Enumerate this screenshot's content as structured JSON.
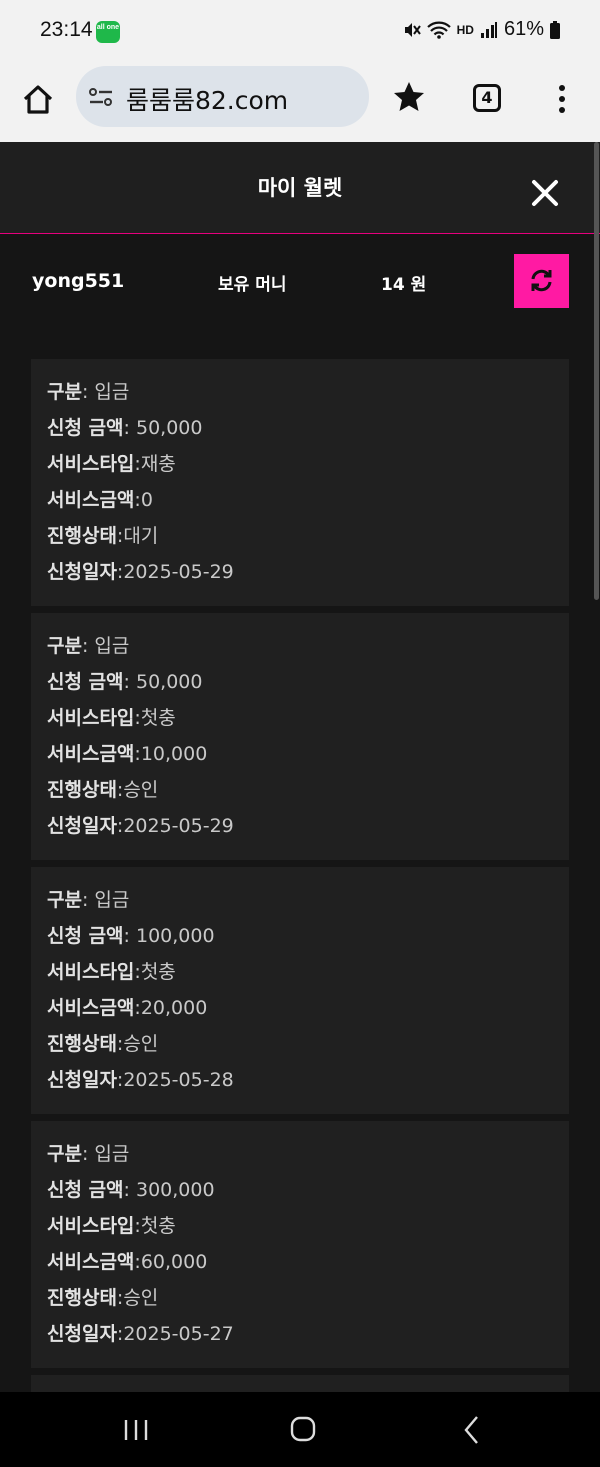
{
  "status_bar": {
    "time": "23:14",
    "app_badge": "all one",
    "hd_label": "HD",
    "battery_text": "61%"
  },
  "browser": {
    "url": "룸룸룸82.com",
    "tab_count": "4"
  },
  "wallet": {
    "title": "마이 월렛",
    "username": "yong551",
    "money_label": "보유 머니",
    "money_value": "14 원",
    "accent_color": "#ff1aa3"
  },
  "labels": {
    "category": "구분",
    "amount": "신청 금액",
    "service_type": "서비스타입",
    "service_amount": "서비스금액",
    "status": "진행상태",
    "date": "신청일자"
  },
  "transactions": [
    {
      "category": "입금",
      "amount": "50,000",
      "service_type": "재충",
      "service_amount": "0",
      "status": "대기",
      "date": "2025-05-29"
    },
    {
      "category": "입금",
      "amount": "50,000",
      "service_type": "첫충",
      "service_amount": "10,000",
      "status": "승인",
      "date": "2025-05-29"
    },
    {
      "category": "입금",
      "amount": "100,000",
      "service_type": "첫충",
      "service_amount": "20,000",
      "status": "승인",
      "date": "2025-05-28"
    },
    {
      "category": "입금",
      "amount": "300,000",
      "service_type": "첫충",
      "service_amount": "60,000",
      "status": "승인",
      "date": "2025-05-27"
    }
  ]
}
